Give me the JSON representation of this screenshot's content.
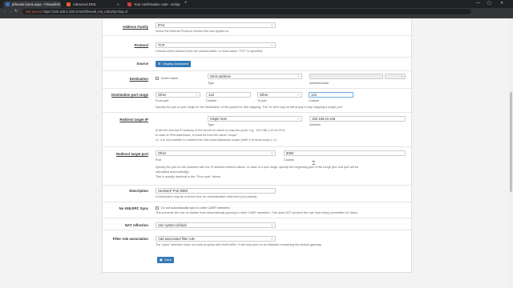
{
  "browser": {
    "tabs": [
      {
        "title": "pfSense.home.arpa - Firewall: N",
        "active": true,
        "color": "#3c6fbd"
      },
      {
        "title": "Advanced DNS",
        "active": false,
        "color": "#e0602b"
      },
      {
        "title": "Your confirmation code - techp",
        "active": false,
        "color": "#cc3b3b"
      }
    ],
    "new_tab": "+",
    "url_warn": "Not secure",
    "url": "https://192.168.0.108:10443/firewall_nat_edit.php?dup=0",
    "win_min": "—",
    "win_max": "▢",
    "win_close": "✕",
    "nav_back": "←",
    "nav_fwd": "→",
    "nav_reload": "↻"
  },
  "form": {
    "address_family": {
      "label": "Address Family",
      "value": "IPv4",
      "help": "Select the Internet Protocol version this rule applies to."
    },
    "protocol": {
      "label": "Protocol",
      "value": "TCP",
      "help": "Choose which protocol this rule should match. In most cases \"TCP\" is specified."
    },
    "source": {
      "label": "Source",
      "button": "Display Advanced"
    },
    "destination": {
      "label": "Destination",
      "invert_label": "Invert match.",
      "type_value": "WAN address",
      "type_caption": "Type",
      "address_caption": "Address/mask",
      "mask_value": ""
    },
    "dest_port_range": {
      "label": "Destination port range",
      "from_value": "Other",
      "from_custom": "143",
      "to_value": "Other",
      "to_custom": "143",
      "from_caption": "From port",
      "custom_caption": "Custom",
      "to_caption": "To port",
      "custom_caption2": "Custom",
      "help": "Specify the port or port range for the destination of the packet for this mapping. The 'to' field may be left empty if only mapping a single port."
    },
    "redirect_ip": {
      "label": "Redirect target IP",
      "type_value": "Single host",
      "address_value": "192.168.10.105",
      "type_caption": "Type",
      "address_caption": "Address",
      "help1": "Enter the internal IP address of the server on which to map the ports. e.g.: 192.168.1.12 for IPv4",
      "help2": "In case of IPv6 addresses, in must be from the same \"scope\",",
      "help3": "i.e. it is not possible to redirect from link-local addresses scope (fe80:*) to local scope (::1)"
    },
    "redirect_port": {
      "label": "Redirect target port",
      "port_value": "Other",
      "custom_value": "8083",
      "port_caption": "Port",
      "custom_caption": "Custom",
      "help1": "Specify the port on the machine with the IP address entered above. In case of a port range, specify the beginning port of the range (the end port will be",
      "help2": "calculated automatically).",
      "help3": "This is usually identical to the \"From port\" above."
    },
    "description": {
      "label": "Description",
      "value": "HestiaCP Port 8083",
      "help": "A description may be entered here for administrative reference (not parsed)."
    },
    "no_xmlrpc": {
      "label": "No XMLRPC Sync",
      "check_label": "Do not automatically sync to other CARP members",
      "help": "This prevents the rule on Master from automatically syncing to other CARP members. This does NOT prevent the rule from being overwritten on Slave."
    },
    "nat_reflection": {
      "label": "NAT reflection",
      "value": "Use system default"
    },
    "filter_rule": {
      "label": "Filter rule association",
      "value": "Add associated filter rule",
      "help": "The \"pass\" selection does not work properly with Multi-WAN. It will only work on an interface containing the default gateway."
    },
    "save_button": "Save"
  }
}
